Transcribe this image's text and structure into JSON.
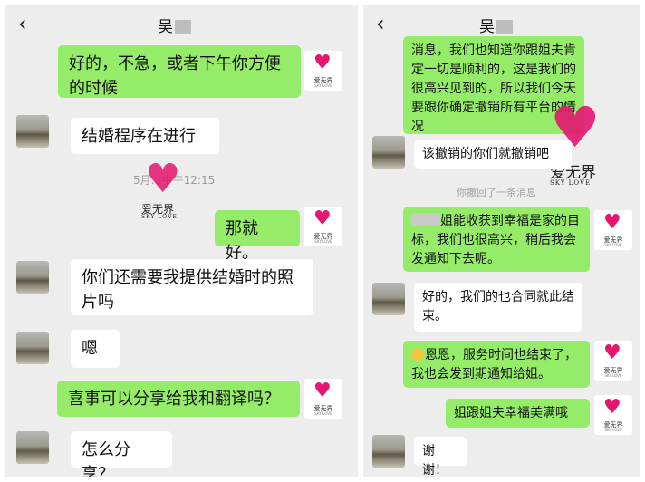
{
  "left_chat": {
    "title": "吴",
    "messages": [
      {
        "from": "me",
        "text": "好的，不急，或者下午你方便的时候"
      },
      {
        "from": "them",
        "text": "结婚程序在进行"
      },
      {
        "from": "me",
        "text": "那就好。"
      },
      {
        "from": "them",
        "text": "你们还需要我提供结婚时的照片吗"
      },
      {
        "from": "them",
        "text": "嗯"
      },
      {
        "from": "me",
        "text": "喜事可以分享给我和翻译吗？"
      },
      {
        "from": "them",
        "text": "怎么分享？"
      }
    ],
    "timestamp": "5月…中午12:15"
  },
  "right_chat": {
    "title": "吴",
    "messages": [
      {
        "from": "me",
        "text": "消息，我们也知道你跟姐夫肯定一切是顺利的，这是我们的很高兴见到的，所以我们今天要跟你确定撤销所有平台的情况"
      },
      {
        "from": "them",
        "text": "该撤销的你们就撤销吧"
      },
      {
        "from": "me",
        "text": "姐能收获到幸福是家的目标，我们也很高兴，稍后我会发通知下去呢。"
      },
      {
        "from": "them",
        "text": "好的，我们的也合同就此结束。"
      },
      {
        "from": "me",
        "text": "恩恩，服务时间也结束了，我也会发到期通知给姐。"
      },
      {
        "from": "me",
        "text": "姐跟姐夫幸福美满哦"
      },
      {
        "from": "them",
        "text": "谢谢！"
      }
    ],
    "system_notice": "你撤回了一条消息"
  },
  "brand": {
    "logo_name": "爱无界",
    "logo_sub": "SKY LOVE",
    "watermark": "爱无界 SKY LOVE",
    "heart_icon": "heart-icon",
    "accent": "#e4166f"
  },
  "colors": {
    "outgoing_bubble": "#95ec69",
    "incoming_bubble": "#ffffff",
    "background": "#ededed"
  },
  "icons": {
    "back": "‹",
    "heart": "♥"
  }
}
